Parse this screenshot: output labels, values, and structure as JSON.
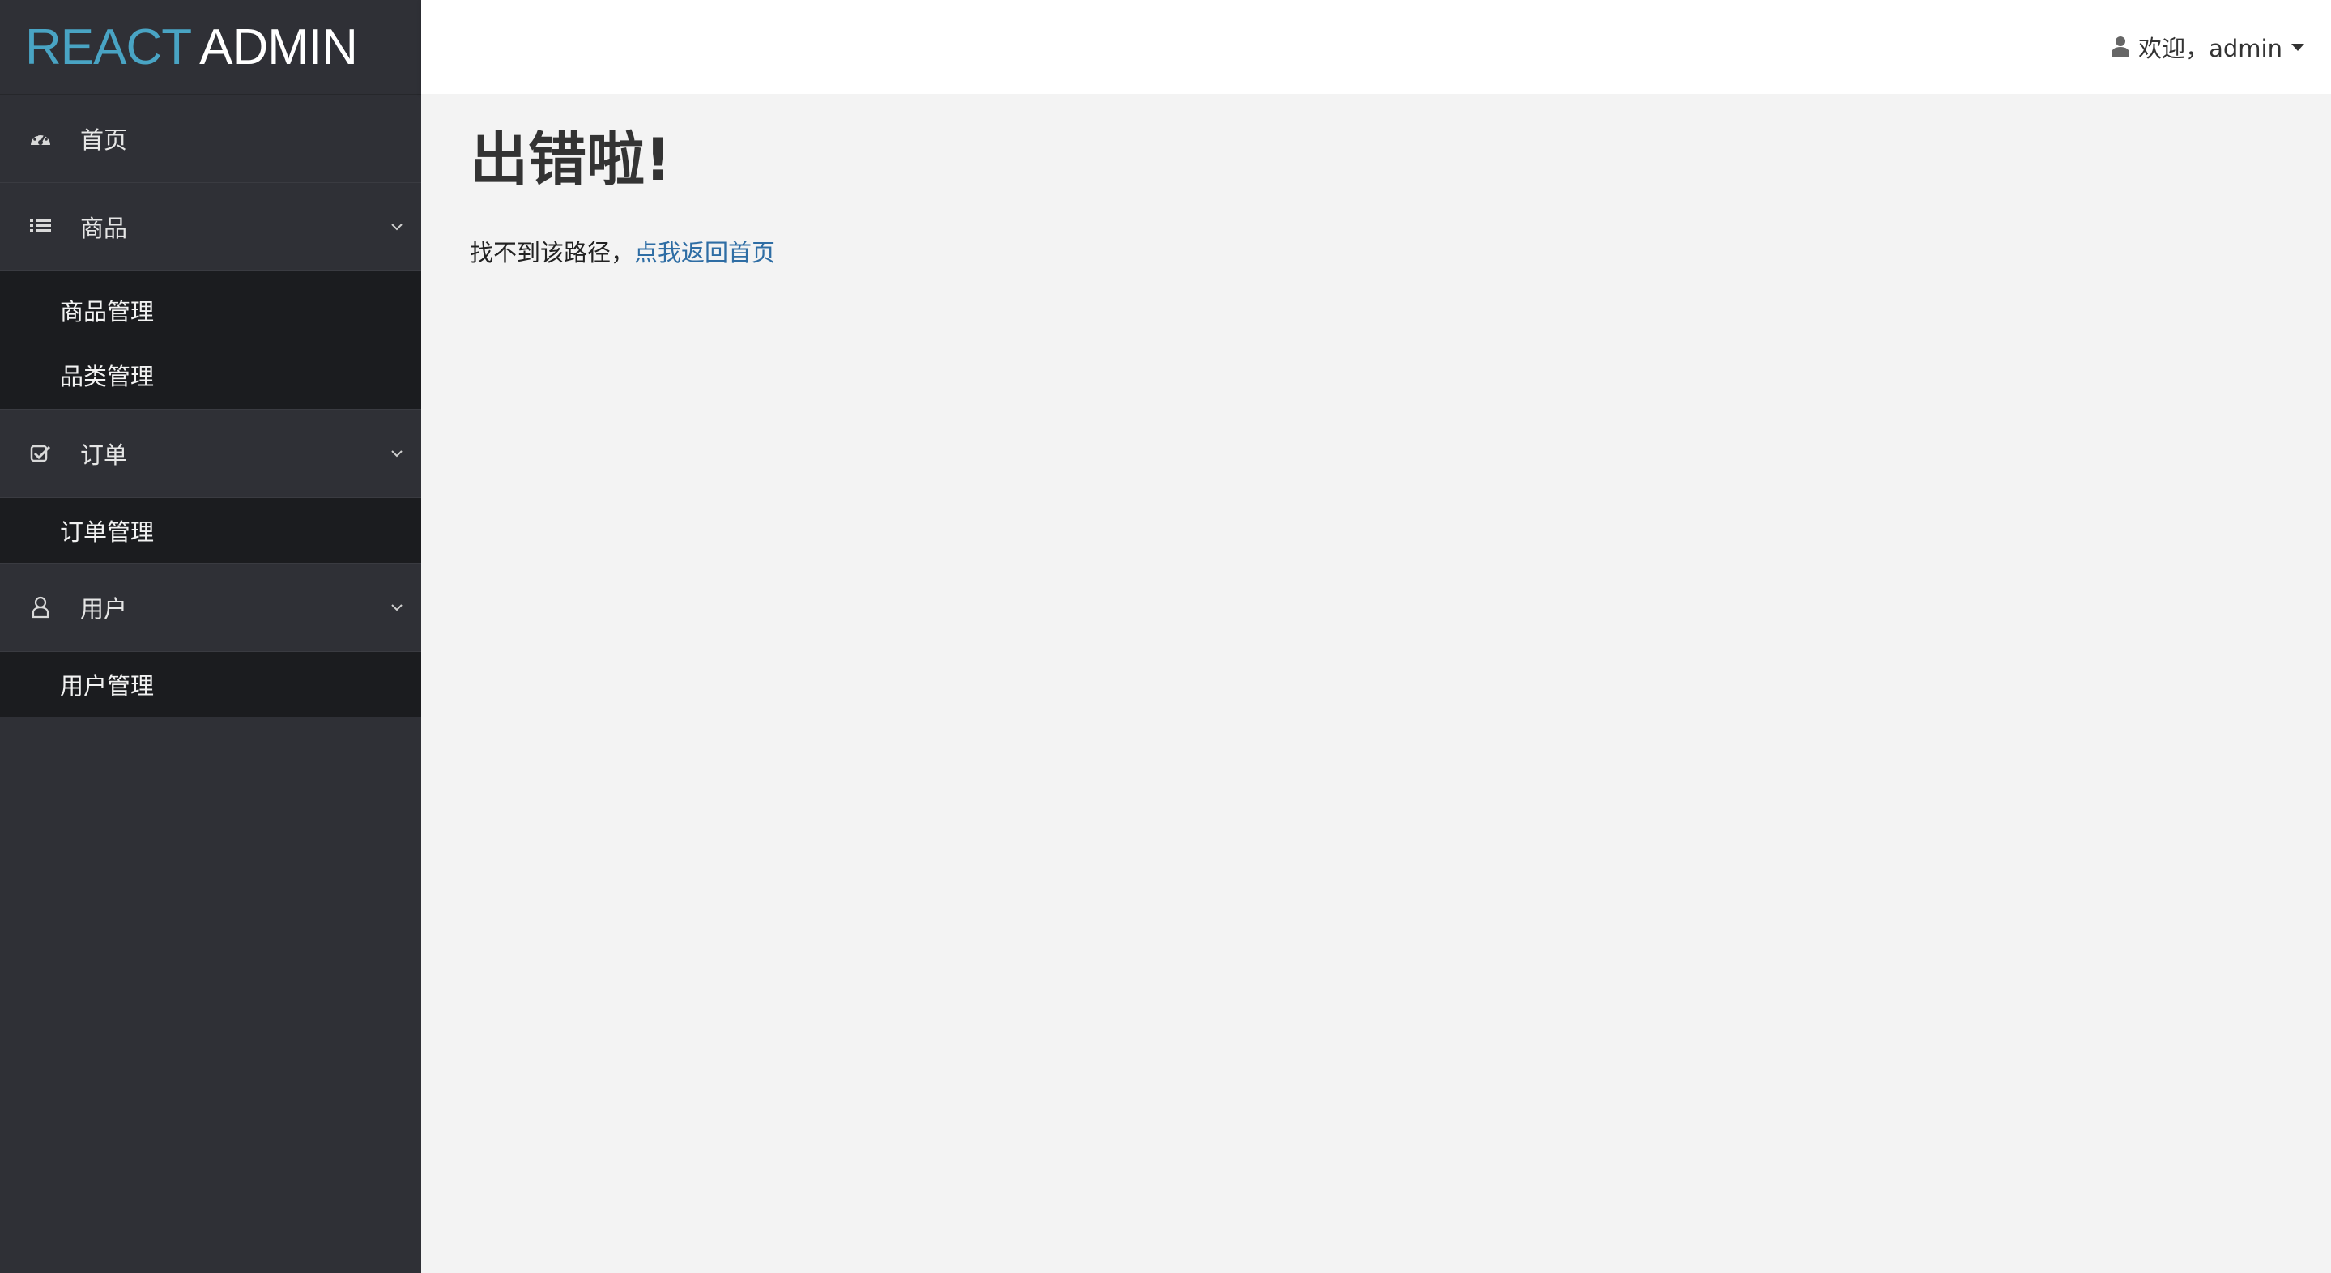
{
  "brand": {
    "part1": "REACT",
    "part2": "ADMIN",
    "color_part1": "#49a4c4",
    "color_part2": "#ffffff"
  },
  "sidebar": {
    "items": [
      {
        "label": "首页",
        "icon": "dashboard-icon"
      },
      {
        "label": "商品",
        "icon": "list-icon",
        "expanded": true,
        "children": [
          "商品管理",
          "品类管理"
        ]
      },
      {
        "label": "订单",
        "icon": "check-square-icon",
        "expanded": true,
        "children": [
          "订单管理"
        ]
      },
      {
        "label": "用户",
        "icon": "user-outline-icon",
        "expanded": true,
        "children": [
          "用户管理"
        ]
      }
    ]
  },
  "header": {
    "welcome": "欢迎，admin",
    "icons": [
      "user-icon",
      "caret-down-icon"
    ]
  },
  "main": {
    "title": "出错啦!",
    "message": "找不到该路径，",
    "link": "点我返回首页",
    "link_color": "#2e6da4"
  }
}
